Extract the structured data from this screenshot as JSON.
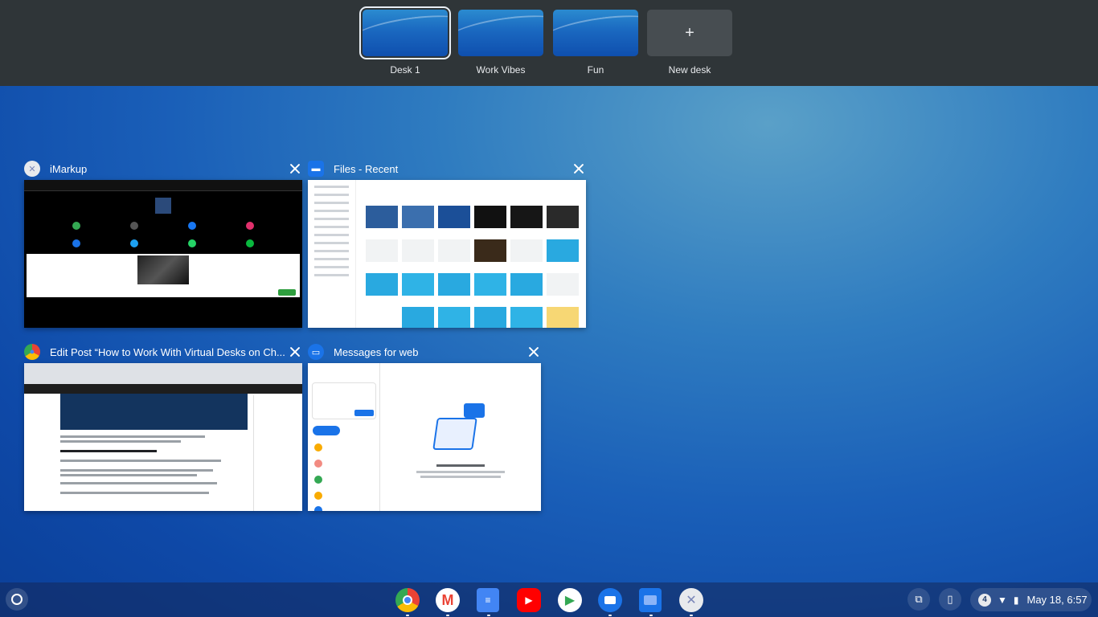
{
  "desks": [
    {
      "label": "Desk 1",
      "active": true
    },
    {
      "label": "Work Vibes",
      "active": false
    },
    {
      "label": "Fun",
      "active": false
    }
  ],
  "new_desk": {
    "symbol": "+",
    "label": "New desk"
  },
  "windows": [
    {
      "title": "iMarkup",
      "icon": "imarkup-icon"
    },
    {
      "title": "Files - Recent",
      "icon": "folder-icon"
    },
    {
      "title": "Edit Post “How to Work With Virtual Desks on Ch...",
      "icon": "chrome-icon"
    },
    {
      "title": "Messages for web",
      "icon": "messages-icon"
    }
  ],
  "shelf": {
    "apps": [
      {
        "name": "chrome-icon",
        "color": "#ea4335"
      },
      {
        "name": "gmail-icon",
        "color": "#ea4335"
      },
      {
        "name": "docs-icon",
        "color": "#4285f4",
        "glyph": "≡"
      },
      {
        "name": "youtube-icon",
        "color": "#ff0000",
        "glyph": "▶"
      },
      {
        "name": "play-store-icon",
        "color": "#34a853",
        "glyph": "▶"
      },
      {
        "name": "messages-icon",
        "color": "#1a73e8"
      },
      {
        "name": "files-icon",
        "color": "#1a73e8"
      },
      {
        "name": "imarkup-icon",
        "color": "#9aa0c8"
      }
    ],
    "status": {
      "notification_count": "4",
      "clock": "May 18, 6:57"
    }
  },
  "colors": {
    "desk_bar": "#2f3538",
    "accent": "#1a73e8"
  }
}
